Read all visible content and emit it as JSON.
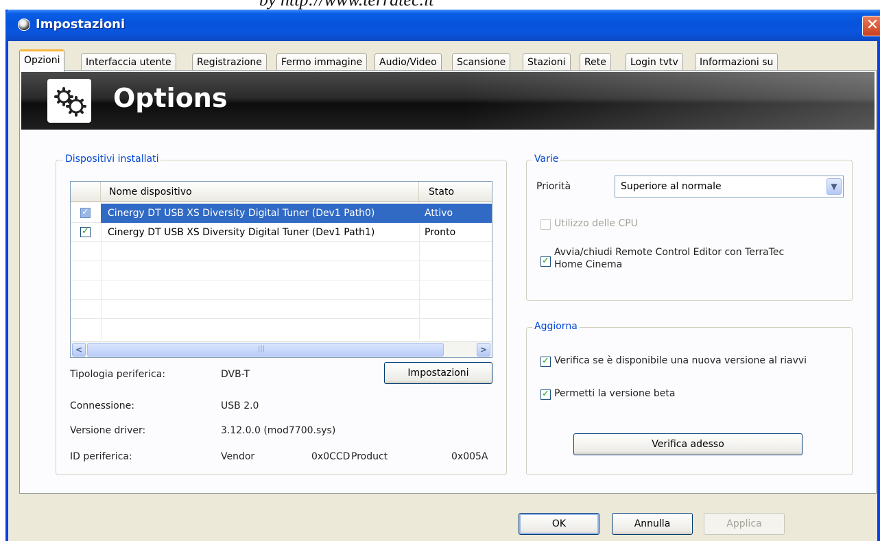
{
  "watermark": "by http://www.terratec.it",
  "window": {
    "title": "Impostazioni",
    "close_glyph": "✕"
  },
  "tabs": [
    "Opzioni",
    "Interfaccia utente",
    "Registrazione",
    "Fermo immagine",
    "Audio/Video",
    "Scansione",
    "Stazioni",
    "Rete",
    "Login tvtv",
    "Informazioni su"
  ],
  "active_tab": "Opzioni",
  "banner": {
    "title": "Options",
    "icon": "gears-icon"
  },
  "devices": {
    "legend": "Dispositivi installati",
    "columns": [
      "Nome dispositivo",
      "Stato"
    ],
    "rows": [
      {
        "name": "Cinergy DT USB XS Diversity Digital Tuner (Dev1 Path0)",
        "stato": "Attivo",
        "checked": true,
        "selected": true
      },
      {
        "name": "Cinergy DT USB XS Diversity Digital Tuner (Dev1 Path1)",
        "stato": "Pronto",
        "checked": true,
        "selected": false
      }
    ],
    "scroll_left": "<",
    "scroll_right": ">",
    "scroll_thumb_grip": "|||",
    "info": {
      "tipologia_label": "Tipologia periferica:",
      "tipologia_value": "DVB-T",
      "connessione_label": "Connessione:",
      "connessione_value": "USB 2.0",
      "driver_label": "Versione driver:",
      "driver_value": "3.12.0.0 (mod7700.sys)",
      "id_label": "ID periferica:",
      "vendor_label": "Vendor",
      "vendor_value": "0x0CCD",
      "product_label": "Product",
      "product_value": "0x005A"
    },
    "settings_button": "Impostazioni"
  },
  "varie": {
    "legend": "Varie",
    "priority_label": "Priorità",
    "priority_value": "Superiore al normale",
    "cpu_label": "Utilizzo delle CPU",
    "cpu_checked": false,
    "remote_label_line1": "Avvia/chiudi Remote Control Editor con TerraTec",
    "remote_label_line2": "Home Cinema",
    "remote_checked": true
  },
  "aggiorna": {
    "legend": "Aggiorna",
    "check_new_label": "Verifica se è disponibile una nuova versione al riavvi",
    "check_new_checked": true,
    "beta_label": "Permetti la versione beta",
    "beta_checked": true,
    "verify_button": "Verifica adesso"
  },
  "footer": {
    "ok": "OK",
    "cancel": "Annulla",
    "apply": "Applica"
  },
  "colors": {
    "accent": "#0046d5",
    "selection": "#316ac5",
    "titlebar": "#0654dc",
    "close": "#c9401f"
  }
}
